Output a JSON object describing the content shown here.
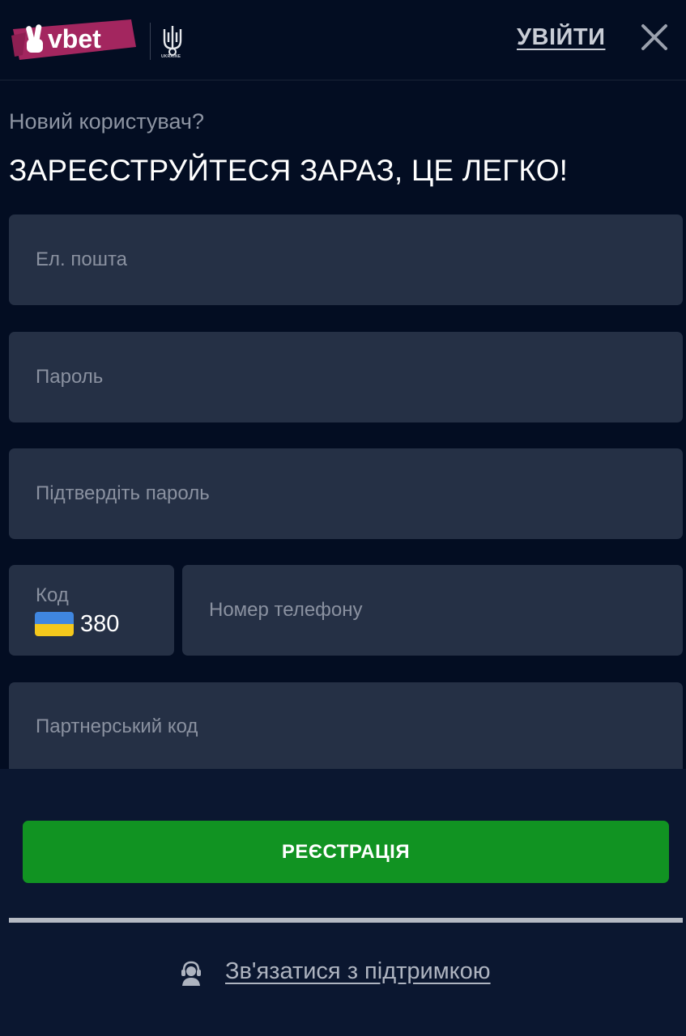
{
  "header": {
    "logo_text": "vbet",
    "crest_text": "UKRAINE",
    "login_label": "УВІЙТИ"
  },
  "intro": {
    "subtitle": "Новий користувач?",
    "title": "ЗАРЕЄСТРУЙТЕСЯ ЗАРАЗ, ЦЕ ЛЕГКО!"
  },
  "form": {
    "email_placeholder": "Ел. пошта",
    "password_placeholder": "Пароль",
    "confirm_placeholder": "Підтвердіть пароль",
    "code_label": "Код",
    "code_value": "380",
    "phone_placeholder": "Номер телефону",
    "partner_placeholder": "Партнерський код"
  },
  "actions": {
    "register_label": "РЕЄСТРАЦІЯ",
    "support_label": "Зв'язатися з підтримкою"
  },
  "colors": {
    "background": "#030d22",
    "field": "#253045",
    "register_button": "#119322",
    "logo_brush": "#a3265f",
    "flag_blue": "#3f86e0",
    "flag_yellow": "#f4c81c"
  }
}
